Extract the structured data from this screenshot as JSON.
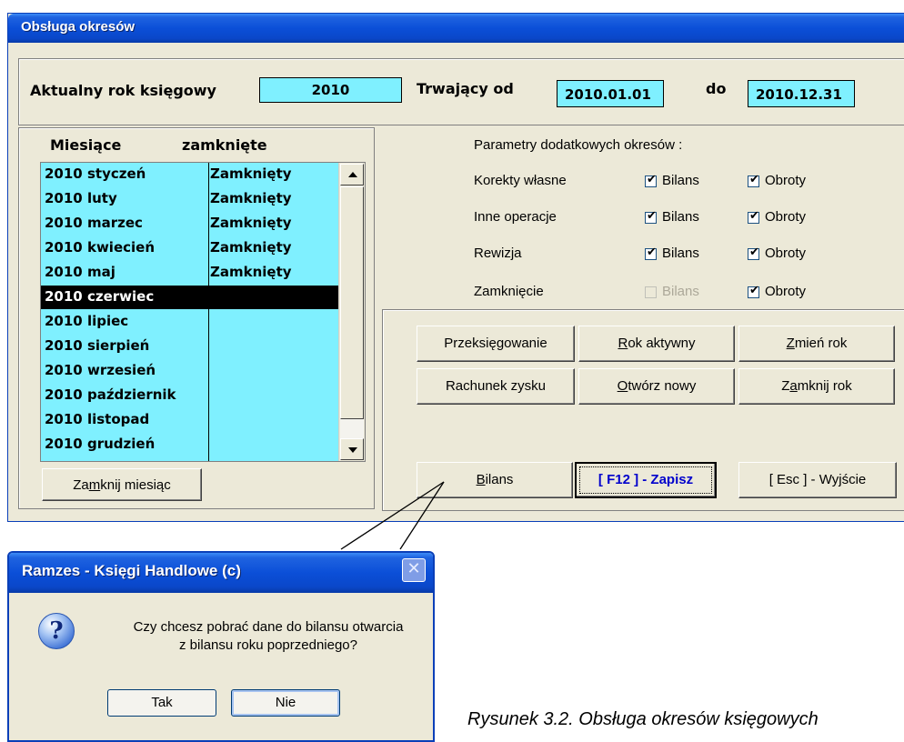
{
  "window": {
    "title": "Obsługa okresów"
  },
  "year": {
    "label": "Aktualny rok księgowy",
    "value": "2010",
    "from_label": "Trwający od",
    "from_value": "2010.01.01",
    "to_label": "do",
    "to_value": "2010.12.31"
  },
  "months": {
    "col_month": "Miesiące",
    "col_closed": "zamknięte",
    "rows": [
      {
        "month": "2010 styczeń",
        "status": "Zamknięty"
      },
      {
        "month": "2010 luty",
        "status": "Zamknięty"
      },
      {
        "month": "2010 marzec",
        "status": "Zamknięty"
      },
      {
        "month": "2010 kwiecień",
        "status": "Zamknięty"
      },
      {
        "month": "2010 maj",
        "status": "Zamknięty"
      },
      {
        "month": "2010 czerwiec",
        "status": ""
      },
      {
        "month": "2010 lipiec",
        "status": ""
      },
      {
        "month": "2010 sierpień",
        "status": ""
      },
      {
        "month": "2010 wrzesień",
        "status": ""
      },
      {
        "month": "2010 październik",
        "status": ""
      },
      {
        "month": "2010 listopad",
        "status": ""
      },
      {
        "month": "2010 grudzień",
        "status": ""
      }
    ],
    "selected_index": 5,
    "close_month_pre": "Za",
    "close_month_key": "m",
    "close_month_post": "knij miesiąc"
  },
  "params": {
    "title": "Parametry dodatkowych okresów :",
    "rows": [
      {
        "label": "Korekty własne",
        "bilans": "Bilans",
        "bilans_checked": true,
        "bilans_enabled": true,
        "obroty": "Obroty",
        "obroty_checked": true
      },
      {
        "label": "Inne operacje",
        "bilans": "Bilans",
        "bilans_checked": true,
        "bilans_enabled": true,
        "obroty": "Obroty",
        "obroty_checked": true
      },
      {
        "label": "Rewizja",
        "bilans": "Bilans",
        "bilans_checked": true,
        "bilans_enabled": true,
        "obroty": "Obroty",
        "obroty_checked": true
      },
      {
        "label": "Zamknięcie",
        "bilans": "Bilans",
        "bilans_checked": false,
        "bilans_enabled": false,
        "obroty": "Obroty",
        "obroty_checked": true
      }
    ]
  },
  "buttons": {
    "przeksiegowanie": "Przeksięgowanie",
    "rok_aktywny_key": "R",
    "rok_aktywny_rest": "ok aktywny",
    "zmien_rok_key": "Z",
    "zmien_rok_rest": "mień rok",
    "rachunek_zysku": "Rachunek zysku",
    "otworz_nowy_key": "O",
    "otworz_nowy_rest": "twórz nowy",
    "zamknij_rok_pre": "Z",
    "zamknij_rok_key": "a",
    "zamknij_rok_post": "mknij rok",
    "bilans_key": "B",
    "bilans_rest": "ilans",
    "zapisz": "[ F12 ] - Zapisz",
    "wyjscie": "[ Esc ] - Wyjście"
  },
  "dialog": {
    "title": "Ramzes - Księgi Handlowe (c)",
    "close_glyph": "✕",
    "icon": "?",
    "line1": "Czy chcesz pobrać dane do bilansu otwarcia",
    "line2": "z bilansu roku poprzedniego?",
    "yes": "Tak",
    "no": "Nie"
  },
  "caption": "Rysunek 3.2. Obsługa okresów księgowych",
  "colors": {
    "list_bg": "#7ff0ff",
    "title_blue": "#0b4fd8",
    "window_bg": "#ece9d8",
    "zapisz_text": "#0000cc"
  }
}
